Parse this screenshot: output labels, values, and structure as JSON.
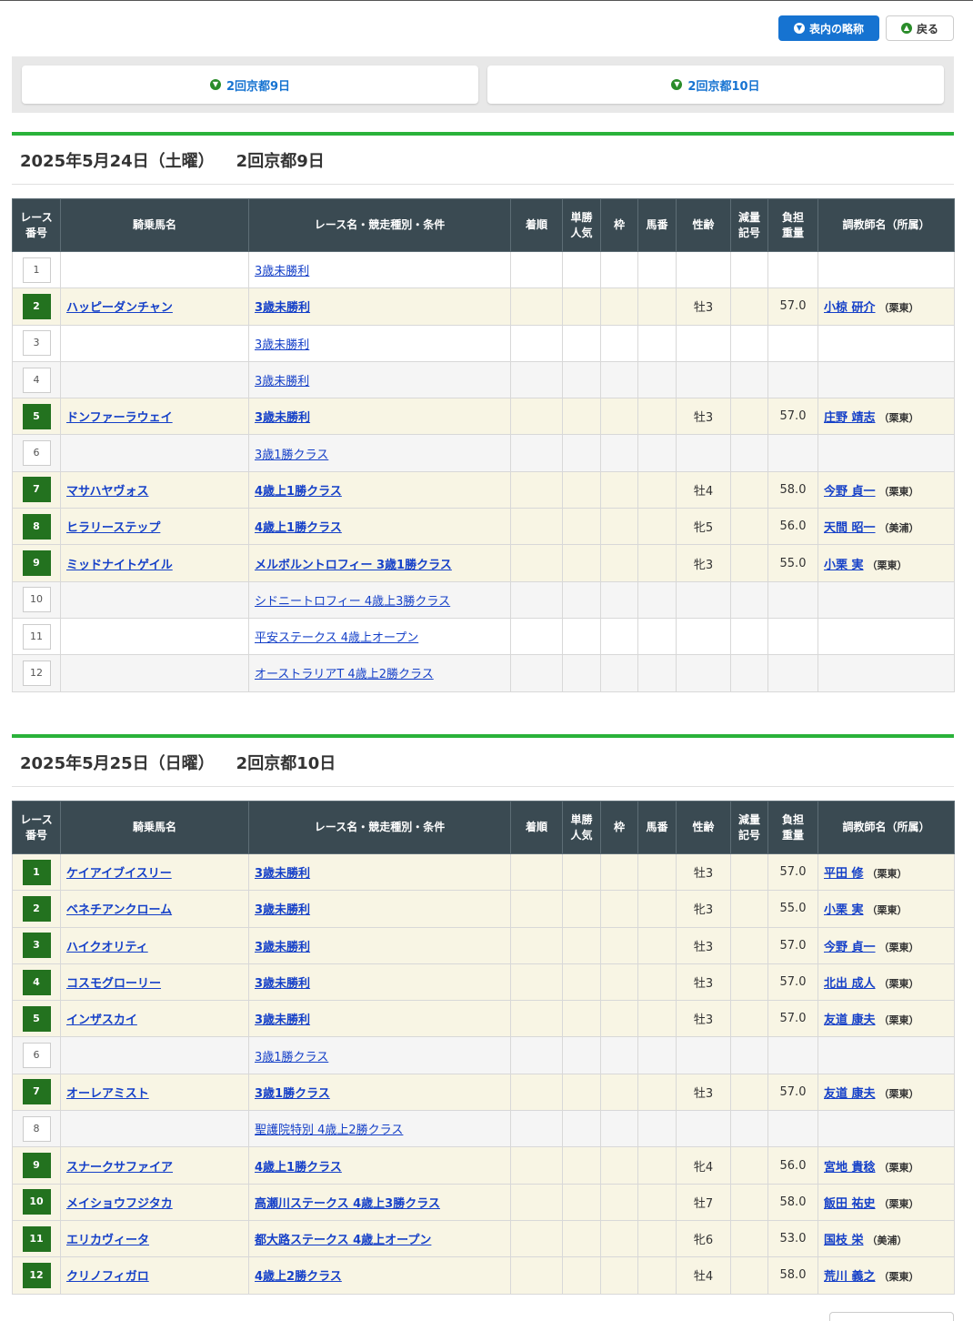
{
  "toolbar": {
    "abbr_label": "表内の略称",
    "back_label": "戻る"
  },
  "day_nav": [
    {
      "label": "2回京都9日"
    },
    {
      "label": "2回京都10日"
    }
  ],
  "headers": [
    "レース番号",
    "騎乗馬名",
    "レース名・競走種別・条件",
    "着順",
    "単勝人気",
    "枠",
    "馬番",
    "性齢",
    "減量記号",
    "負担重量",
    "調教師名（所属）"
  ],
  "sections": [
    {
      "date": "2025年5月24日（土曜）",
      "meet": "2回京都9日",
      "races": [
        {
          "num": "1",
          "horse": "",
          "race": "3歳未勝利",
          "sex_age": "",
          "weight": "",
          "trainer": "",
          "affil": ""
        },
        {
          "num": "2",
          "horse": "ハッピーダンチャン",
          "race": "3歳未勝利",
          "sex_age": "牡3",
          "weight": "57.0",
          "trainer": "小椋 研介",
          "affil": "（栗東）"
        },
        {
          "num": "3",
          "horse": "",
          "race": "3歳未勝利",
          "sex_age": "",
          "weight": "",
          "trainer": "",
          "affil": ""
        },
        {
          "num": "4",
          "horse": "",
          "race": "3歳未勝利",
          "sex_age": "",
          "weight": "",
          "trainer": "",
          "affil": ""
        },
        {
          "num": "5",
          "horse": "ドンファーラウェイ",
          "race": "3歳未勝利",
          "sex_age": "牡3",
          "weight": "57.0",
          "trainer": "庄野 靖志",
          "affil": "（栗東）"
        },
        {
          "num": "6",
          "horse": "",
          "race": "3歳1勝クラス",
          "sex_age": "",
          "weight": "",
          "trainer": "",
          "affil": ""
        },
        {
          "num": "7",
          "horse": "マサハヤヴォス",
          "race": "4歳上1勝クラス",
          "sex_age": "牡4",
          "weight": "58.0",
          "trainer": "今野 貞一",
          "affil": "（栗東）"
        },
        {
          "num": "8",
          "horse": "ヒラリーステップ",
          "race": "4歳上1勝クラス",
          "sex_age": "牝5",
          "weight": "56.0",
          "trainer": "天間 昭一",
          "affil": "（美浦）"
        },
        {
          "num": "9",
          "horse": "ミッドナイトゲイル",
          "race": "メルボルントロフィー 3歳1勝クラス",
          "sex_age": "牝3",
          "weight": "55.0",
          "trainer": "小栗 実",
          "affil": "（栗東）"
        },
        {
          "num": "10",
          "horse": "",
          "race": "シドニートロフィー 4歳上3勝クラス",
          "sex_age": "",
          "weight": "",
          "trainer": "",
          "affil": ""
        },
        {
          "num": "11",
          "horse": "",
          "race": "平安ステークス 4歳上オープン",
          "sex_age": "",
          "weight": "",
          "trainer": "",
          "affil": ""
        },
        {
          "num": "12",
          "horse": "",
          "race": "オーストラリアT 4歳上2勝クラス",
          "sex_age": "",
          "weight": "",
          "trainer": "",
          "affil": ""
        }
      ]
    },
    {
      "date": "2025年5月25日（日曜）",
      "meet": "2回京都10日",
      "races": [
        {
          "num": "1",
          "horse": "ケイアイブイスリー",
          "race": "3歳未勝利",
          "sex_age": "牡3",
          "weight": "57.0",
          "trainer": "平田 修",
          "affil": "（栗東）"
        },
        {
          "num": "2",
          "horse": "ベネチアンクローム",
          "race": "3歳未勝利",
          "sex_age": "牝3",
          "weight": "55.0",
          "trainer": "小栗 実",
          "affil": "（栗東）"
        },
        {
          "num": "3",
          "horse": "ハイクオリティ",
          "race": "3歳未勝利",
          "sex_age": "牡3",
          "weight": "57.0",
          "trainer": "今野 貞一",
          "affil": "（栗東）"
        },
        {
          "num": "4",
          "horse": "コスモグローリー",
          "race": "3歳未勝利",
          "sex_age": "牡3",
          "weight": "57.0",
          "trainer": "北出 成人",
          "affil": "（栗東）"
        },
        {
          "num": "5",
          "horse": "インザスカイ",
          "race": "3歳未勝利",
          "sex_age": "牡3",
          "weight": "57.0",
          "trainer": "友道 康夫",
          "affil": "（栗東）"
        },
        {
          "num": "6",
          "horse": "",
          "race": "3歳1勝クラス",
          "sex_age": "",
          "weight": "",
          "trainer": "",
          "affil": ""
        },
        {
          "num": "7",
          "horse": "オーレアミスト",
          "race": "3歳1勝クラス",
          "sex_age": "牡3",
          "weight": "57.0",
          "trainer": "友道 康夫",
          "affil": "（栗東）"
        },
        {
          "num": "8",
          "horse": "",
          "race": "聖護院特別 4歳上2勝クラス",
          "sex_age": "",
          "weight": "",
          "trainer": "",
          "affil": ""
        },
        {
          "num": "9",
          "horse": "スナークサファイア",
          "race": "4歳上1勝クラス",
          "sex_age": "牝4",
          "weight": "56.0",
          "trainer": "宮地 貴稔",
          "affil": "（栗東）"
        },
        {
          "num": "10",
          "horse": "メイショウフジタカ",
          "race": "高瀬川ステークス 4歳上3勝クラス",
          "sex_age": "牡7",
          "weight": "58.0",
          "trainer": "飯田 祐史",
          "affil": "（栗東）"
        },
        {
          "num": "11",
          "horse": "エリカヴィータ",
          "race": "都大路ステークス 4歳上オープン",
          "sex_age": "牝6",
          "weight": "53.0",
          "trainer": "国枝 栄",
          "affil": "（美浦）"
        },
        {
          "num": "12",
          "horse": "クリノフィガロ",
          "race": "4歳上2勝クラス",
          "sex_age": "牡4",
          "weight": "58.0",
          "trainer": "荒川 義之",
          "affil": "（栗東）"
        }
      ]
    }
  ],
  "colors": {
    "accent": "#1673d1",
    "section_bar": "#2ab23a",
    "header_bg": "#3a4a52",
    "ridden_bg": "#f8f5e4",
    "num_on": "#23721f",
    "link": "#1540c8"
  },
  "icons": {
    "abbr": "chevron-down-circle-icon",
    "back": "chevron-up-circle-icon",
    "day": "chevron-down-circle-icon"
  }
}
